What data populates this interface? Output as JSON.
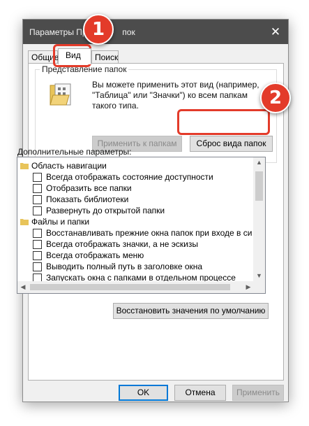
{
  "window": {
    "title": "Параметры Про",
    "title_tail": "пок",
    "close_glyph": "✕"
  },
  "tabs": [
    {
      "label": "Общие"
    },
    {
      "label": "Вид"
    },
    {
      "label": "Поиск"
    }
  ],
  "folder_views": {
    "legend": "Представление папок",
    "description": "Вы можете применить этот вид (например, \"Таблица\" или \"Значки\") ко всем папкам такого типа.",
    "apply_button": "Применить к папкам",
    "reset_button": "Сброс вида папок"
  },
  "advanced": {
    "label": "Дополнительные параметры:",
    "items": [
      {
        "type": "folder",
        "label": "Область навигации"
      },
      {
        "type": "check",
        "label": "Всегда отображать состояние доступности",
        "checked": false
      },
      {
        "type": "check",
        "label": "Отобразить все папки",
        "checked": false
      },
      {
        "type": "check",
        "label": "Показать библиотеки",
        "checked": false
      },
      {
        "type": "check",
        "label": "Развернуть до открытой папки",
        "checked": false
      },
      {
        "type": "folder",
        "label": "Файлы и папки"
      },
      {
        "type": "check",
        "label": "Восстанавливать прежние окна папок при входе в си",
        "checked": false
      },
      {
        "type": "check",
        "label": "Всегда отображать значки, а не эскизы",
        "checked": false
      },
      {
        "type": "check",
        "label": "Всегда отображать меню",
        "checked": false
      },
      {
        "type": "check",
        "label": "Выводить полный путь в заголовке окна",
        "checked": false
      },
      {
        "type": "check",
        "label": "Запускать окна с папками в отдельном процессе",
        "checked": false
      }
    ],
    "restore_defaults_button": "Восстановить значения по умолчанию"
  },
  "footer": {
    "ok": "OK",
    "cancel": "Отмена",
    "apply": "Применить"
  },
  "callouts": [
    {
      "number": "1"
    },
    {
      "number": "2"
    }
  ],
  "colors": {
    "callout": "#e33b2a",
    "titlebar": "#4c4c4c",
    "accent": "#0078d7"
  }
}
